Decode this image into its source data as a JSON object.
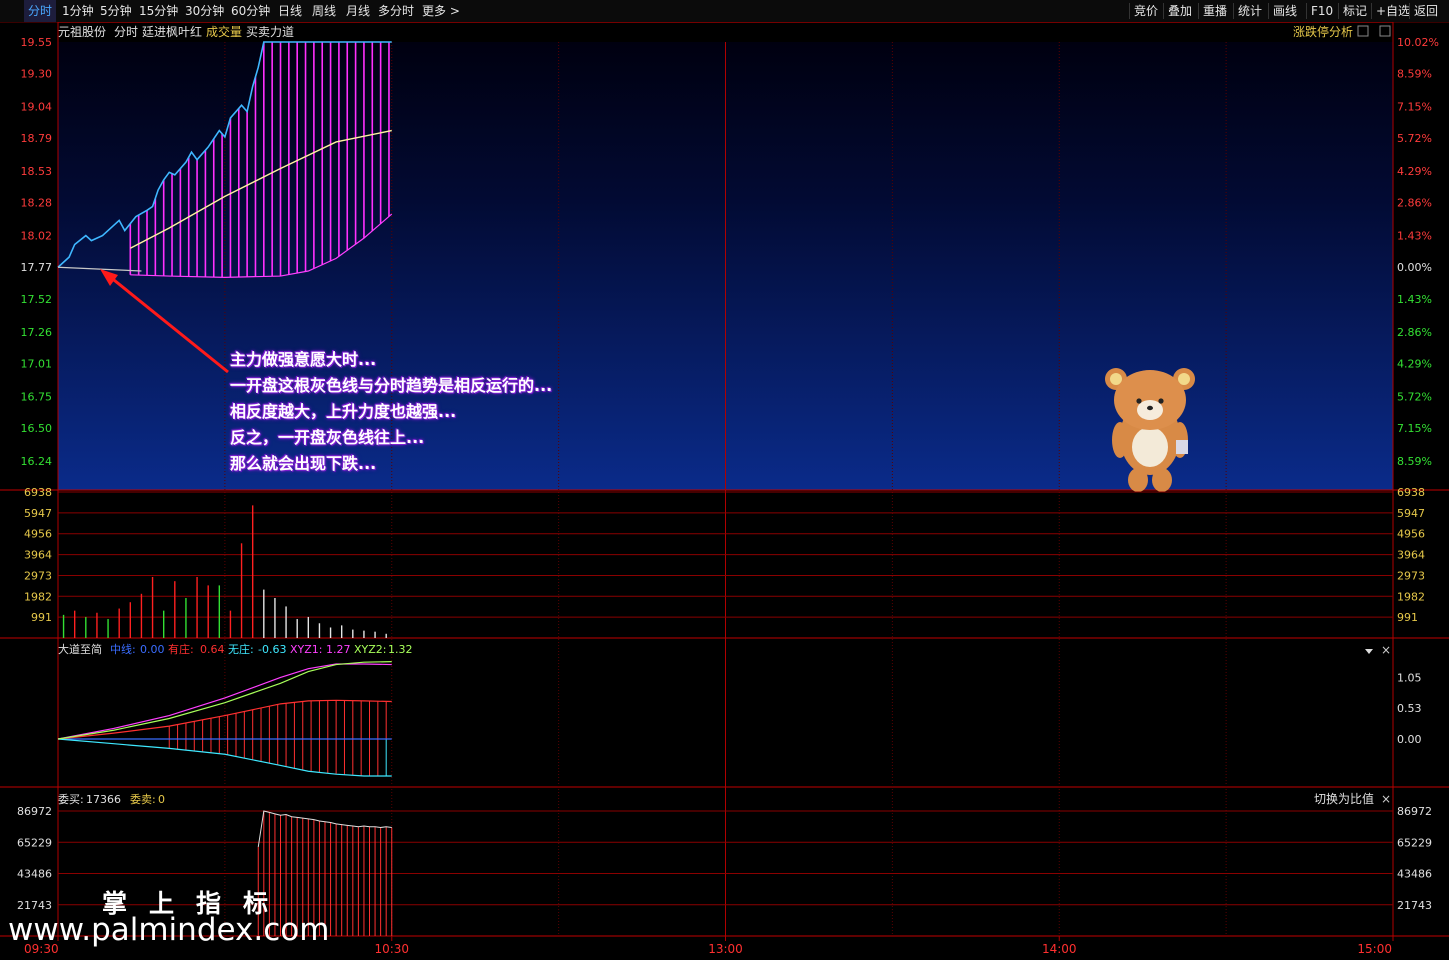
{
  "toolbar": {
    "left_tabs": [
      "分时",
      "1分钟",
      "5分钟",
      "15分钟",
      "30分钟",
      "60分钟",
      "日线",
      "周线",
      "月线",
      "多分时",
      "更多 >"
    ],
    "right_buttons": [
      "竞价",
      "叠加",
      "重播",
      "统计",
      "画线",
      "F10",
      "标记",
      "+自选",
      "返回"
    ]
  },
  "header": {
    "stock_name": "元祖股份",
    "mode": "分时",
    "indicator": "廷进枫叶红",
    "volume_label": "成交量",
    "power_label": "买卖力道",
    "analysis_label": "涨跌停分析"
  },
  "annotation": {
    "lines": [
      "主力做强意愿大时...",
      "一开盘这根灰色线与分时趋势是相反运行的...",
      "相反度越大，上升力度也越强...",
      "反之，一开盘灰色线往上...",
      "那么就会出现下跌..."
    ]
  },
  "panel_indicator": {
    "name": "大道至简",
    "mid_label": "中线:",
    "mid_value": "0.00",
    "you_label": "有庄:",
    "you_value": "0.64",
    "wu_label": "无庄:",
    "wu_value": "-0.63",
    "xyz1_label": "XYZ1:",
    "xyz1_value": "1.27",
    "xyz2_label": "XYZ2:",
    "xyz2_value": "1.32"
  },
  "panel_orders": {
    "buy_label": "委买:",
    "buy_value": "17366",
    "sell_label": "委卖:",
    "sell_value": "0",
    "switch_label": "切换为比值"
  },
  "watermark": {
    "cn": "掌上指标",
    "url": "www.palmindex.com"
  },
  "chart_data": [
    {
      "type": "line",
      "panel": "price",
      "y_ticks": [
        "19.55",
        "19.30",
        "19.04",
        "18.79",
        "18.53",
        "18.28",
        "18.02",
        "17.77",
        "17.52",
        "17.26",
        "17.01",
        "16.75",
        "16.50",
        "16.24"
      ],
      "pct_ticks": [
        "10.02%",
        "8.59%",
        "7.15%",
        "5.72%",
        "4.29%",
        "2.86%",
        "1.43%",
        "0.00%",
        "1.43%",
        "2.86%",
        "4.29%",
        "5.72%",
        "7.15%",
        "8.59%"
      ],
      "x_ticks": [
        "09:30",
        "10:30",
        "13:00",
        "14:00",
        "15:00"
      ],
      "ylim": [
        16.12,
        19.55
      ],
      "prev_close": 17.77,
      "x_minutes": [
        0,
        2,
        3,
        5,
        6,
        8,
        10,
        11,
        12,
        14,
        16,
        17,
        18,
        19,
        20,
        21,
        23,
        24,
        25,
        27,
        29,
        30,
        31,
        33,
        34,
        35,
        36,
        37,
        38,
        40,
        41,
        42,
        43,
        45,
        46,
        48,
        50,
        52,
        54,
        56,
        58,
        60
      ],
      "price": [
        17.77,
        17.85,
        17.95,
        18.02,
        17.98,
        18.02,
        18.1,
        18.14,
        18.06,
        18.17,
        18.22,
        18.25,
        18.38,
        18.46,
        18.52,
        18.5,
        18.6,
        18.68,
        18.62,
        18.72,
        18.85,
        18.8,
        18.95,
        19.05,
        19.0,
        19.2,
        19.35,
        19.55,
        19.55,
        19.55,
        19.55,
        19.55,
        19.55,
        19.55,
        19.55,
        19.55,
        19.55,
        19.55,
        19.55,
        19.55,
        19.55,
        19.55
      ],
      "avg_line": {
        "x_minutes": [
          13,
          20,
          30,
          40,
          50,
          60
        ],
        "values": [
          17.92,
          18.08,
          18.33,
          18.55,
          18.76,
          18.85
        ]
      },
      "lower_band": {
        "x_minutes": [
          13,
          20,
          30,
          40,
          45,
          50,
          55,
          60
        ],
        "values": [
          17.71,
          17.7,
          17.69,
          17.7,
          17.74,
          17.84,
          18.0,
          18.19
        ]
      },
      "gray_line": {
        "x_minutes": [
          0,
          15
        ],
        "values": [
          17.77,
          17.74
        ]
      }
    },
    {
      "type": "bar",
      "panel": "volume",
      "y_ticks": [
        "6938",
        "5947",
        "4956",
        "3964",
        "2973",
        "1982",
        "991"
      ],
      "ylim": [
        0,
        6938
      ],
      "x_minutes": [
        1,
        3,
        5,
        7,
        9,
        11,
        13,
        15,
        17,
        19,
        21,
        23,
        25,
        27,
        29,
        31,
        33,
        35,
        37,
        39,
        41,
        43,
        45,
        47,
        49,
        51,
        53,
        55,
        57,
        59
      ],
      "volume": [
        1100,
        1300,
        1000,
        1200,
        900,
        1400,
        1700,
        2100,
        2900,
        1300,
        2700,
        1900,
        2900,
        2500,
        2500,
        1300,
        4500,
        6300,
        2300,
        1900,
        1500,
        900,
        1000,
        700,
        500,
        600,
        400,
        350,
        300,
        200
      ],
      "colors": [
        "g",
        "r",
        "g",
        "r",
        "g",
        "r",
        "r",
        "r",
        "r",
        "g",
        "r",
        "g",
        "r",
        "r",
        "g",
        "r",
        "r",
        "r",
        "w",
        "w",
        "w",
        "w",
        "w",
        "w",
        "w",
        "w",
        "w",
        "w",
        "w",
        "w"
      ]
    },
    {
      "type": "line",
      "panel": "indicator",
      "y_ticks": [
        "1.05",
        "0.53",
        "0.00"
      ],
      "ylim": [
        -0.75,
        1.45
      ],
      "x_minutes": [
        0,
        10,
        20,
        30,
        40,
        45,
        50,
        55,
        60
      ],
      "you": [
        0.0,
        0.1,
        0.22,
        0.4,
        0.6,
        0.65,
        0.66,
        0.65,
        0.64
      ],
      "wu": [
        0.0,
        -0.08,
        -0.16,
        -0.26,
        -0.45,
        -0.55,
        -0.6,
        -0.63,
        -0.63
      ],
      "xyz1": [
        0.0,
        0.18,
        0.4,
        0.7,
        1.05,
        1.2,
        1.28,
        1.28,
        1.27
      ],
      "xyz2": [
        0.0,
        0.15,
        0.35,
        0.62,
        0.95,
        1.15,
        1.27,
        1.31,
        1.32
      ],
      "bars_from_minute": 20
    },
    {
      "type": "bar",
      "panel": "orders",
      "y_ticks": [
        "86972",
        "65229",
        "43486",
        "21743"
      ],
      "ylim": [
        0,
        86972
      ],
      "x_minutes": [
        36,
        37,
        38,
        39,
        40,
        41,
        42,
        43,
        44,
        45,
        46,
        47,
        48,
        49,
        50,
        51,
        52,
        53,
        54,
        55,
        56,
        57,
        58,
        59,
        60
      ],
      "buy": [
        62000,
        87000,
        86000,
        85000,
        84000,
        84500,
        83000,
        82500,
        82000,
        81500,
        81000,
        80000,
        79500,
        79000,
        78000,
        77500,
        77000,
        76500,
        76000,
        76500,
        76000,
        76000,
        75500,
        76000,
        75500
      ]
    }
  ]
}
